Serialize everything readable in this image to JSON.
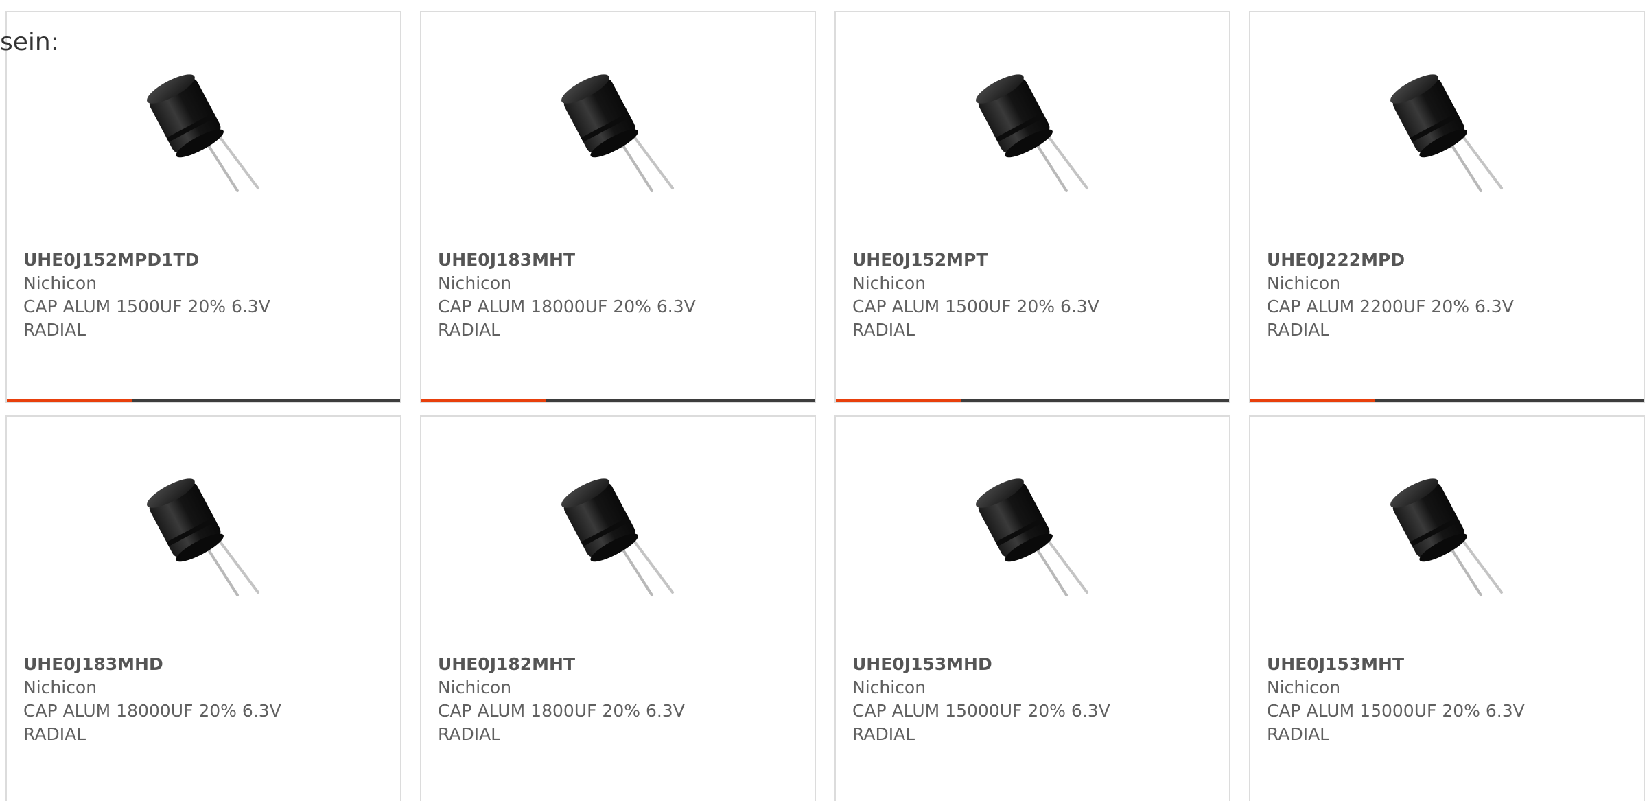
{
  "intro_text": "sein:",
  "colors": {
    "accent": "#e8400c",
    "bar": "#3d3d3d",
    "border": "#dcdcdc"
  },
  "products": [
    {
      "part_number": "UHE0J152MPD1TD",
      "manufacturer": "Nichicon",
      "description_line1": "CAP ALUM 1500UF 20% 6.3V",
      "description_line2": "RADIAL"
    },
    {
      "part_number": "UHE0J183MHT",
      "manufacturer": "Nichicon",
      "description_line1": "CAP ALUM 18000UF 20% 6.3V",
      "description_line2": "RADIAL"
    },
    {
      "part_number": "UHE0J152MPT",
      "manufacturer": "Nichicon",
      "description_line1": "CAP ALUM 1500UF 20% 6.3V",
      "description_line2": "RADIAL"
    },
    {
      "part_number": "UHE0J222MPD",
      "manufacturer": "Nichicon",
      "description_line1": "CAP ALUM 2200UF 20% 6.3V",
      "description_line2": "RADIAL"
    },
    {
      "part_number": "UHE0J183MHD",
      "manufacturer": "Nichicon",
      "description_line1": "CAP ALUM 18000UF 20% 6.3V",
      "description_line2": "RADIAL"
    },
    {
      "part_number": "UHE0J182MHT",
      "manufacturer": "Nichicon",
      "description_line1": "CAP ALUM 1800UF 20% 6.3V",
      "description_line2": "RADIAL"
    },
    {
      "part_number": "UHE0J153MHD",
      "manufacturer": "Nichicon",
      "description_line1": "CAP ALUM 15000UF 20% 6.3V",
      "description_line2": "RADIAL"
    },
    {
      "part_number": "UHE0J153MHT",
      "manufacturer": "Nichicon",
      "description_line1": "CAP ALUM 15000UF 20% 6.3V",
      "description_line2": "RADIAL"
    }
  ]
}
